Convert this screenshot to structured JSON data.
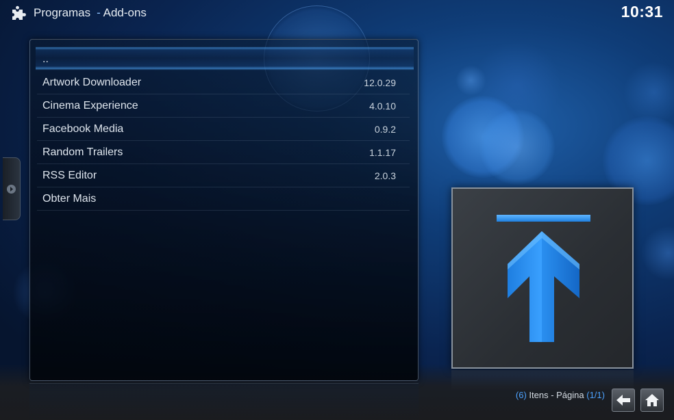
{
  "header": {
    "section": "Programas",
    "separator": "-",
    "current": "Add-ons",
    "clock": "10:31"
  },
  "list": {
    "up_label": "..",
    "items": [
      {
        "name": "Artwork Downloader",
        "version": "12.0.29"
      },
      {
        "name": "Cinema Experience",
        "version": "4.0.10"
      },
      {
        "name": "Facebook Media",
        "version": "0.9.2"
      },
      {
        "name": "Random Trailers",
        "version": "1.1.17"
      },
      {
        "name": "RSS Editor",
        "version": "2.0.3"
      },
      {
        "name": "Obter Mais",
        "version": ""
      }
    ]
  },
  "footer": {
    "count_open": "(",
    "count_value": "6",
    "count_close": ")",
    "count_text": " Itens - Página ",
    "page_open": "(",
    "page_value": "1/1",
    "page_close": ")"
  },
  "icons": {
    "section_icon": "puzzle-icon",
    "thumbnail_icon": "up-arrow-icon",
    "back": "back-arrow-icon",
    "home": "home-icon",
    "side_tab": "chevron-right-icon"
  },
  "colors": {
    "accent": "#4da3ff",
    "arrow": "#2a8ff0"
  }
}
